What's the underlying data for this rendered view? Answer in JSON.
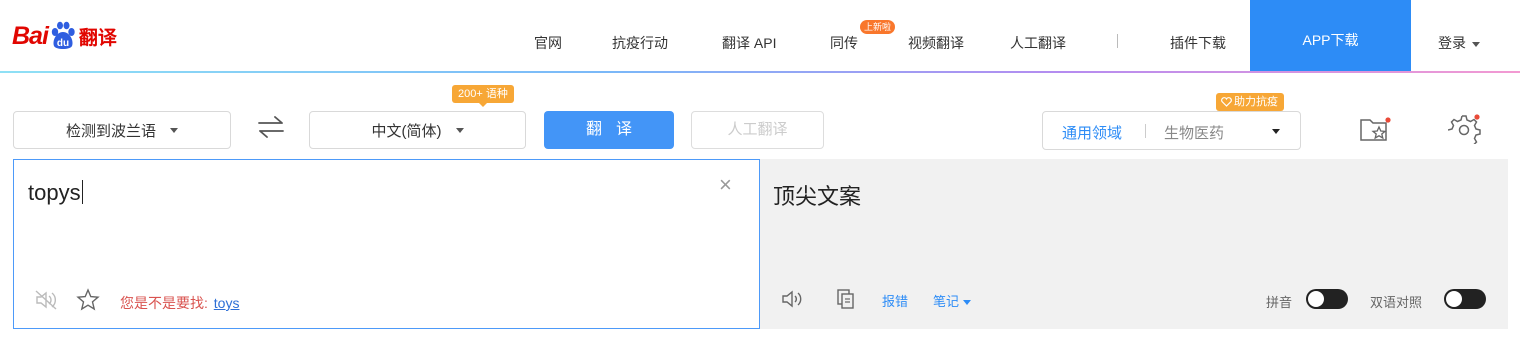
{
  "brand": {
    "logo_prefix": "Bai",
    "logo_du": "du",
    "logo_suffix": "翻译"
  },
  "nav": {
    "items": [
      "官网",
      "抗疫行动",
      "翻译 API",
      "同传",
      "视频翻译",
      "人工翻译",
      "插件下载"
    ],
    "new_badge": "上新啦",
    "app_download": "APP下载",
    "login": "登录"
  },
  "toolbar": {
    "source_lang": "检测到波兰语",
    "target_lang": "中文(简体)",
    "lang_count_badge": "200+ 语种",
    "translate_label": "翻译",
    "human_translate_label": "人工翻译",
    "domain_badge": "助力抗疫",
    "domain_general": "通用领域",
    "domain_bio": "生物医药"
  },
  "source": {
    "text": "topys",
    "suggest_prefix": "您是不是要找:",
    "suggest_word": "toys"
  },
  "target": {
    "text": "顶尖文案",
    "report_error": "报错",
    "notes": "笔记",
    "pinyin_label": "拼音",
    "bilingual_label": "双语对照"
  },
  "colors": {
    "accent": "#2d8cf6",
    "brand_red": "#e10601",
    "badge_orange": "#f7a736"
  }
}
